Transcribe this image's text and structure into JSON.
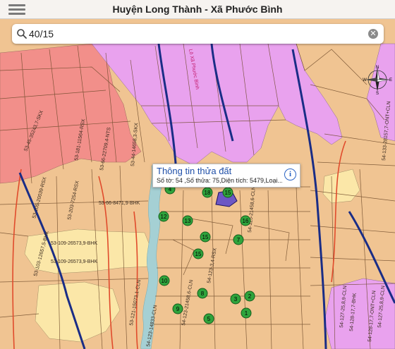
{
  "header": {
    "title": "Huyện Long Thành - Xã Phước Bình"
  },
  "search": {
    "value": "40/15"
  },
  "popup": {
    "title": "Thông tin thửa đất",
    "detail": "Số tờ: 54 ,Số thửa: 75,Diện tích: 5479,Loại..."
  },
  "compass": {
    "n": "N",
    "e": "E",
    "s": "S",
    "w": "W"
  },
  "colors": {
    "residential": "#f0c492",
    "forest": "#f28f8a",
    "industrial": "#e9a2ee",
    "agriculture": "#fbe7a8",
    "water": "#a5d0d4",
    "highlight": "#6d57c4",
    "marker": "#2fa43c",
    "main_road": "#1a2d86"
  },
  "road_labels": [
    "53-45-35243,7-SKX",
    "53-181-11564-RSX",
    "53-66-22709,4-NTS",
    "53-44-14658,3-SKX",
    "53-105-20039-RSX",
    "53-203-7254-RSX",
    "53-66-8471,9-BHK",
    "53-109-26573,9-BHK",
    "53-109-26573,9-BHK",
    "53-103-12657,5-BHK",
    "54-125-21458,6-CLN",
    "54-123-3,4-RSX",
    "54-123-21458,6-CLN",
    "53-121-15073,1-CLN",
    "54-123-14833-CLN",
    "54-127-25,8,9-CLN",
    "54-128-17,7-BHK",
    "54-133-28157,7-ONT+CLN",
    "54-127-25,8,9-CLN",
    "54-128-17,7-ONT+CLN",
    "Lô Xã Phước Bình"
  ],
  "markers": [
    "4",
    "18",
    "15",
    "13",
    "16",
    "12",
    "15",
    "15",
    "10",
    "7",
    "8",
    "9",
    "3",
    "2",
    "1",
    "5"
  ]
}
